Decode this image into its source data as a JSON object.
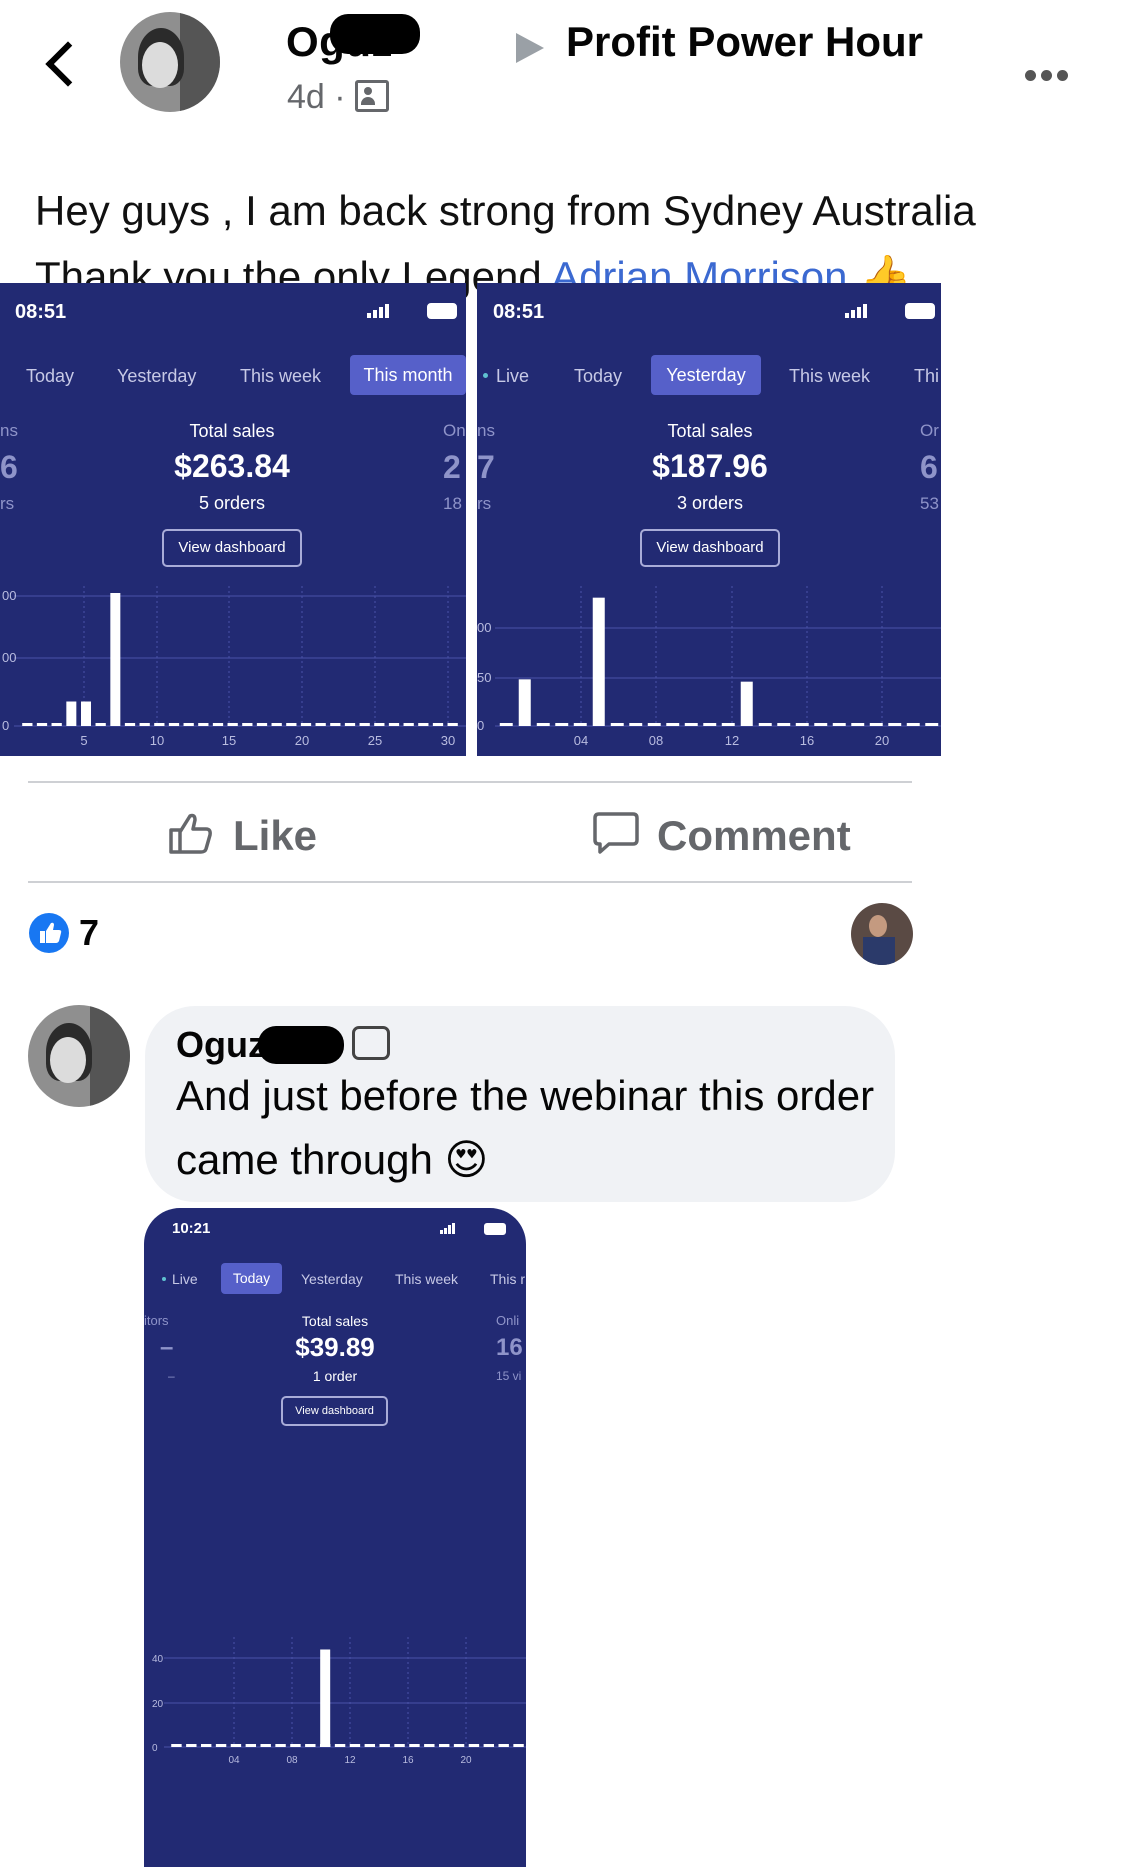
{
  "post": {
    "author": "Oguz",
    "group": "Profit Power Hour",
    "time_ago": "4d",
    "separator": "·",
    "line1": "Hey guys , I am back strong from Sydney Australia",
    "line2_prefix": "Thank you the only Legend ",
    "mention": "Adrian Morrison",
    "emoji": "👍"
  },
  "screenshots": [
    {
      "time": "08:51",
      "tabs": [
        "Today",
        "Yesterday",
        "This week",
        "This month"
      ],
      "active_tab": "This month",
      "left_side": {
        "top": "ns",
        "big": "6",
        "bottom": "rs"
      },
      "right_side": {
        "top": "On ns",
        "big": "2 7",
        "bottom": "18 ors"
      },
      "total_label": "Total sales",
      "total": "$263.84",
      "orders": "5 orders",
      "button": "View dashboard",
      "y_ticks": [
        "00",
        "00",
        "0"
      ],
      "x_ticks": [
        "5",
        "10",
        "15",
        "20",
        "25",
        "30"
      ]
    },
    {
      "time": "08:51",
      "tabs": [
        "Live",
        "Today",
        "Yesterday",
        "This week",
        "Thi"
      ],
      "active_tab": "Yesterday",
      "right_side": {
        "top": "Or",
        "big": "6",
        "bottom": "53"
      },
      "total_label": "Total sales",
      "total": "$187.96",
      "orders": "3 orders",
      "button": "View dashboard",
      "y_ticks": [
        "00",
        "50",
        "0"
      ],
      "x_ticks": [
        "04",
        "08",
        "12",
        "16",
        "20"
      ]
    },
    {
      "time": "10:21",
      "tabs": [
        "Live",
        "Today",
        "Yesterday",
        "This week",
        "This r"
      ],
      "active_tab": "Today",
      "left_side": {
        "top": "itors",
        "big": "–",
        "bottom": "–"
      },
      "right_side": {
        "top": "Onli",
        "big": "16",
        "bottom": "15 vi"
      },
      "total_label": "Total sales",
      "total": "$39.89",
      "orders": "1 order",
      "button": "View dashboard",
      "y_ticks": [
        "40",
        "20",
        "0"
      ],
      "x_ticks": [
        "04",
        "08",
        "12",
        "16",
        "20"
      ]
    }
  ],
  "actions": {
    "like": "Like",
    "comment": "Comment"
  },
  "reactions": {
    "count": "7"
  },
  "comment": {
    "author": "Oguz",
    "text": "And just before the webinar this order came through",
    "emoji": "😍"
  },
  "colors": {
    "link": "#3b69d1",
    "screen_bg": "#222a73",
    "active_tab": "#5660c9",
    "like_blue": "#1877f2"
  },
  "chart_data": [
    {
      "type": "bar",
      "x": [
        1,
        2,
        3,
        4,
        5,
        6,
        7,
        8,
        9,
        10,
        11,
        12,
        13,
        14,
        15,
        16,
        17,
        18,
        19,
        20,
        21,
        22,
        23,
        24,
        25,
        26,
        27,
        28,
        29,
        30
      ],
      "values": [
        0,
        0,
        0,
        35,
        35,
        0,
        190,
        0,
        0,
        0,
        0,
        0,
        0,
        0,
        0,
        0,
        0,
        0,
        0,
        0,
        0,
        0,
        0,
        0,
        0,
        0,
        0,
        0,
        0,
        0
      ],
      "x_ticks": [
        5,
        10,
        15,
        20,
        25,
        30
      ],
      "ylim": [
        0,
        200
      ]
    },
    {
      "type": "bar",
      "x": [
        0,
        1,
        2,
        3,
        4,
        5,
        6,
        7,
        8,
        9,
        10,
        11,
        12,
        13,
        14,
        15,
        16,
        17,
        18,
        19,
        20,
        21,
        22,
        23
      ],
      "values": [
        0,
        40,
        0,
        0,
        0,
        110,
        0,
        0,
        0,
        0,
        0,
        0,
        0,
        38,
        0,
        0,
        0,
        0,
        0,
        0,
        0,
        0,
        0,
        0
      ],
      "x_ticks": [
        "04",
        "08",
        "12",
        "16",
        "20"
      ],
      "y_ticks": [
        0,
        50,
        100
      ],
      "ylim": [
        0,
        120
      ]
    },
    {
      "type": "bar",
      "x": [
        0,
        1,
        2,
        3,
        4,
        5,
        6,
        7,
        8,
        9,
        10,
        11,
        12,
        13,
        14,
        15,
        16,
        17,
        18,
        19,
        20,
        21,
        22,
        23
      ],
      "values": [
        0,
        0,
        0,
        0,
        0,
        0,
        0,
        0,
        0,
        0,
        0,
        0,
        0,
        0,
        0,
        0,
        0,
        0,
        0,
        0,
        0,
        0,
        0,
        0
      ],
      "peak": {
        "x": 10,
        "value": 39.89
      },
      "x_ticks": [
        "04",
        "08",
        "12",
        "16",
        "20"
      ],
      "y_ticks": [
        0,
        20,
        40
      ],
      "ylim": [
        0,
        45
      ]
    }
  ]
}
